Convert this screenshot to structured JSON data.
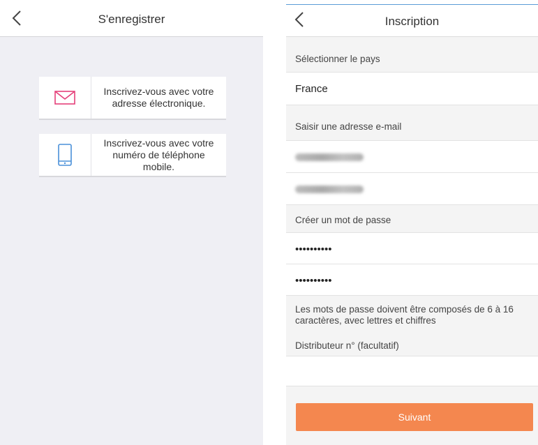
{
  "left": {
    "title": "S'enregistrer",
    "options": [
      {
        "label": "Inscrivez-vous avec votre adresse électronique.",
        "icon": "envelope-icon",
        "icon_color": "#e5407a"
      },
      {
        "label": "Inscrivez-vous avec votre numéro de téléphone mobile.",
        "icon": "mobile-phone-icon",
        "icon_color": "#4a90d9"
      }
    ]
  },
  "right": {
    "title": "Inscription",
    "country_section_label": "Sélectionner le pays",
    "country_value": "France",
    "email_section_label": "Saisir une adresse e-mail",
    "email_value": "[blurred]",
    "email_confirm_value": "[blurred]",
    "password_section_label": "Créer un mot de passe",
    "password_value": "••••••••••",
    "password_confirm_value": "••••••••••",
    "password_hint": "Les mots de passe doivent être composés de 6 à 16 caractères, avec lettres et chiffres",
    "distributor_label": "Distributeur n° (facultatif)",
    "distributor_value": "",
    "next_button": "Suivant"
  },
  "colors": {
    "accent": "#f4874f",
    "email_icon": "#e5407a",
    "phone_icon": "#4a90d9",
    "background": "#efeff4"
  }
}
